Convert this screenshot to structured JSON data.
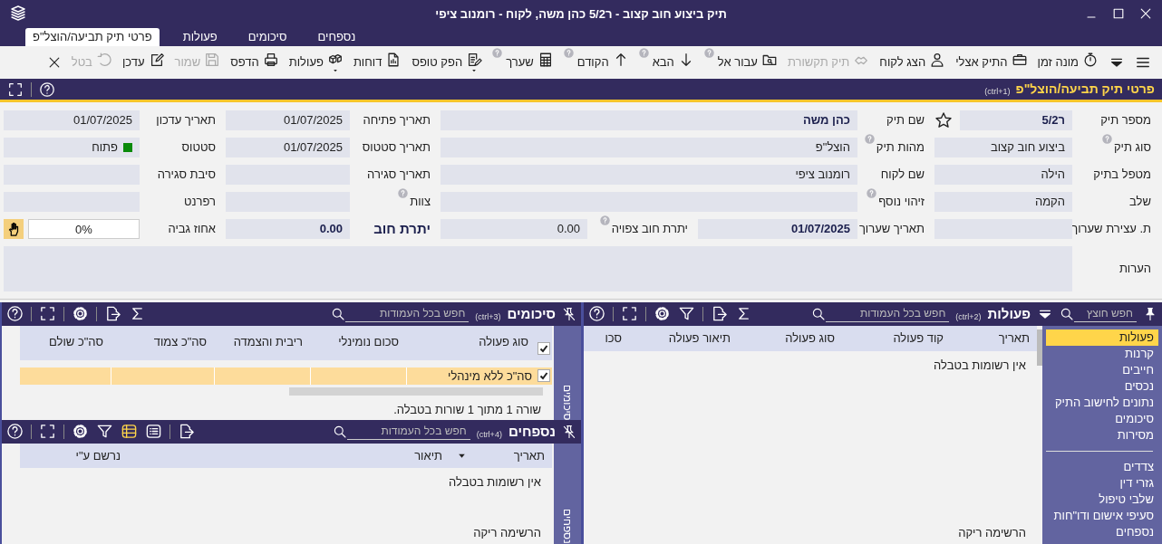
{
  "window": {
    "title": "תיק ביצוע חוב קצוב - ר5/2 כהן משה, לקוח - רומנוב ציפי"
  },
  "tabs": [
    {
      "label": "נספחים",
      "selected": false
    },
    {
      "label": "סיכומים",
      "selected": false
    },
    {
      "label": "פעולות",
      "selected": false
    },
    {
      "label": "פרטי תיק תביעה/הוצל\"פ",
      "selected": true
    }
  ],
  "toolbar": [
    {
      "label": "מונה זמן",
      "disabled": false,
      "help": false,
      "dropdown": false
    },
    {
      "label": "התיק אצלי",
      "disabled": false,
      "help": false,
      "dropdown": false
    },
    {
      "label": "הצג לקוח",
      "disabled": false,
      "help": false,
      "dropdown": false
    },
    {
      "label": "תיק תקשורת",
      "disabled": true,
      "help": false,
      "dropdown": false
    },
    {
      "label": "עבור אל",
      "disabled": false,
      "help": true,
      "dropdown": false
    },
    {
      "label": "הבא",
      "disabled": false,
      "help": true,
      "dropdown": false
    },
    {
      "label": "הקודם",
      "disabled": false,
      "help": true,
      "dropdown": false
    },
    {
      "label": "שערך",
      "disabled": false,
      "help": true,
      "dropdown": false
    },
    {
      "label": "הפק טופס",
      "disabled": false,
      "help": false,
      "dropdown": true
    },
    {
      "label": "דוחות",
      "disabled": false,
      "help": false,
      "dropdown": false
    },
    {
      "label": "פעולות",
      "disabled": false,
      "help": false,
      "dropdown": true
    },
    {
      "label": "הדפס",
      "disabled": false,
      "help": false,
      "dropdown": false
    },
    {
      "label": "שמור",
      "disabled": true,
      "help": false,
      "dropdown": false
    },
    {
      "label": "עדכן",
      "disabled": false,
      "help": false,
      "dropdown": false
    },
    {
      "label": "בטל",
      "disabled": true,
      "help": false,
      "dropdown": false
    }
  ],
  "section": {
    "title": "פרטי תיק תביעה/הוצל\"פ",
    "shortcut": "(ctrl+1)"
  },
  "form": {
    "rows": [
      [
        {
          "label": "מספר תיק",
          "value": "ר5/2",
          "bold": true,
          "starred": false
        },
        {
          "label": "שם תיק",
          "value": "כהן משה",
          "bold": true
        },
        "",
        {
          "label": "תאריך פתיחה",
          "value": "01/07/2025"
        },
        {
          "label": "תאריך עדכון",
          "value": "01/07/2025"
        }
      ],
      [
        {
          "label": "סוג תיק",
          "help": true,
          "value": "ביצוע חוב קצוב"
        },
        {
          "label": "מהות תיק",
          "help": true,
          "value": "הוצל\"פ"
        },
        "",
        {
          "label": "תאריך סטטוס",
          "value": "01/07/2025"
        },
        {
          "label": "סטטוס",
          "value": "פתוח",
          "color": "#0a8a0a"
        }
      ],
      [
        {
          "label": "מטפל בתיק",
          "value": "הילה"
        },
        {
          "label": "שם לקוח",
          "value": "רומנוב ציפי"
        },
        "",
        {
          "label": "תאריך סגירה"
        },
        {
          "label": "סיבת סגירה"
        }
      ],
      [
        {
          "label": "שלב",
          "value": "הקמה"
        },
        {
          "label": "זיהוי נוסף",
          "help": true
        },
        "",
        {
          "label": "צוות",
          "help": true
        },
        {
          "label": "רפרנט"
        }
      ],
      [
        {
          "label": "ת. עצירת שערוך"
        },
        {
          "label": "תאריך שערוך",
          "value": "01/07/2025",
          "bold": true
        },
        {
          "label": "יתרת חוב צפויה",
          "help": true,
          "value": "0.00"
        },
        {
          "label": "יתרת חוב",
          "strong_label": true,
          "value": "0.00",
          "bold": true
        },
        {
          "label": "אחוז גביה",
          "value": "0%",
          "kind": "percent"
        }
      ]
    ],
    "notes": {
      "label": "הערות"
    }
  },
  "actions_panel": {
    "tab_search_placeholder": "חפש חוצץ",
    "title": "פעולות",
    "shortcut": "(ctrl+2)",
    "search_placeholder": "חפש בכל העמודות",
    "nav_groups": [
      [
        {
          "label": "פעולות",
          "selected": true
        },
        {
          "label": "קרנות",
          "selected": false
        },
        {
          "label": "חייבים",
          "selected": false
        },
        {
          "label": "נכסים",
          "selected": false
        },
        {
          "label": "נתונים לחישוב התיק",
          "selected": false
        },
        {
          "label": "סיכומים",
          "selected": false
        },
        {
          "label": "מסירות",
          "selected": false
        }
      ],
      [
        {
          "label": "צדדים",
          "selected": false
        },
        {
          "label": "גזרי דין",
          "selected": false
        },
        {
          "label": "שלבי טיפול",
          "selected": false
        },
        {
          "label": "סעיפי אישום ודו\"חות",
          "selected": false
        },
        {
          "label": "נספחים",
          "selected": false
        }
      ]
    ],
    "columns": [
      "תאריך",
      "קוד פעולה",
      "סוג פעולה",
      "תיאור פעולה",
      "סכו"
    ],
    "empty_message": "אין רשומות בטבלה",
    "footer": "הרשימה ריקה"
  },
  "summaries_panel": {
    "title": "סיכומים",
    "shortcut": "(ctrl+3)",
    "search_placeholder": "חפש בכל העמודות",
    "side_label": "סיכומים",
    "select_all_checked": true,
    "columns": [
      "סוג פעולה",
      "סכום נומינלי",
      "ריבית והצמדה",
      "סה\"כ צמוד",
      "סה\"כ שולם"
    ],
    "rows": [
      {
        "label": "סה\"כ ללא מינהלי",
        "checked": true,
        "selected": true
      }
    ],
    "footer": "שורה 1 מתוך 1 שורות בטבלה."
  },
  "annexes_panel": {
    "title": "נספחים",
    "shortcut": "(ctrl+4)",
    "search_placeholder": "חפש בכל העמודות",
    "side_label": "נספחים",
    "views": [
      {
        "selected": false
      },
      {
        "selected": true
      }
    ],
    "columns": [
      {
        "label": "תאריך",
        "sorted": true
      },
      {
        "label": "תיאור",
        "sorted": false
      },
      {
        "label": "נרשם ע\"י",
        "sorted": false
      }
    ],
    "empty_message": "אין רשומות בטבלה",
    "footer": "הרשימה ריקה"
  }
}
